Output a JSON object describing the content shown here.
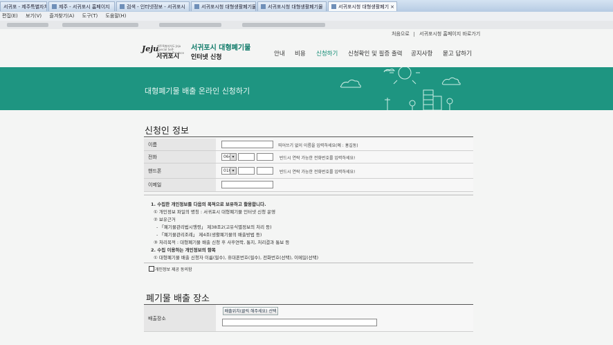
{
  "browser": {
    "tabs": [
      {
        "label": "서귀포 - 제주특별자치도"
      },
      {
        "label": "제주 - 서귀포시 홈페이지"
      },
      {
        "label": "검색 - 인터넷정보 - 서귀포시"
      },
      {
        "label": "서귀포시청 대형생활폐기물"
      },
      {
        "label": "서귀포시청 대형생활폐기물"
      },
      {
        "label": "서귀포시청 대형생활폐기"
      }
    ],
    "close_glyph": "×",
    "menu": [
      "편집(E)",
      "보기(V)",
      "즐겨찾기(A)",
      "도구(T)",
      "도움말(H)"
    ]
  },
  "header": {
    "util_links": [
      "처음으로",
      "서귀포시청 홈페이지 바로가기"
    ],
    "logo_mark": "Jeju",
    "logo_tiny": "제주특별자치도 Jeju Special Self-Governing Province",
    "logo_city": "서귀포시",
    "brand_line1": "서귀포시 대형폐기물",
    "brand_line2": "인터넷 신청",
    "nav": [
      "안내",
      "비용",
      "신청하기",
      "신청확인 및 필증 출력",
      "공지사항",
      "묻고 답하기"
    ],
    "active_nav_index": 2
  },
  "hero": {
    "title": "대형폐기물 배출 온라인 신청하기"
  },
  "applicant": {
    "title": "신청인 정보",
    "fields": [
      {
        "label": "이름",
        "hint": "띄어쓰기 없이 이름을 입력하세요(예 : 홍길동)"
      },
      {
        "label": "전화",
        "select": "064",
        "hint": "반드시 연락 가능한 전화번호를 입력하세요!"
      },
      {
        "label": "핸드폰",
        "select": "010",
        "hint": "반드시 연락 가능한 전화번호를 입력하세요!"
      },
      {
        "label": "이메일"
      }
    ]
  },
  "privacy": {
    "lines": [
      "1. 수집한 개인정보를 다음의 목적으로 보유하고 활용합니다.",
      "① 개인정보 파일의 명칭 : 서귀포시 대형폐기물 인터넷 신청 운영",
      "② 보유근거",
      "- 「폐기물관리법시행령」 제38조2(고유식별정보의 처리 등)",
      "- 「폐기물관리조례」 제4조(생활폐기물의 배출방법 등)",
      "③ 처리목적 : 대형폐기물 배출 신청 후 사후연락, 통지, 처리결과 통보 등",
      "2. 수집 이용하는 개인정보의 항목",
      "① 대형폐기물 배출 신청자 이름(필수), 휴대폰번호(필수), 전화번호(선택), 이메일(선택)"
    ],
    "consent_label": "개인정보 제공 동의함"
  },
  "location": {
    "title": "폐기물 배출 장소",
    "field_label": "배출장소",
    "button_label": "배출위치(클릭 해주세요) 선택"
  }
}
